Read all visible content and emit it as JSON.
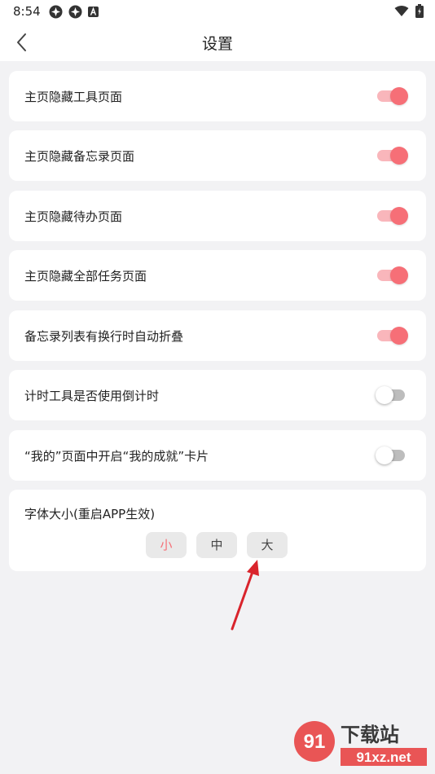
{
  "status_bar": {
    "time": "8:54",
    "left_icons": [
      "app-icon",
      "app-icon",
      "a-badge-icon"
    ],
    "right_icons": [
      "wifi-icon",
      "battery-icon"
    ]
  },
  "app_bar": {
    "title": "设置",
    "back_icon": "chevron-left-icon"
  },
  "settings": [
    {
      "label": "主页隐藏工具页面",
      "on": true
    },
    {
      "label": "主页隐藏备忘录页面",
      "on": true
    },
    {
      "label": "主页隐藏待办页面",
      "on": true
    },
    {
      "label": "主页隐藏全部任务页面",
      "on": true
    },
    {
      "label": "备忘录列表有换行时自动折叠",
      "on": true
    },
    {
      "label": "计时工具是否使用倒计时",
      "on": false
    },
    {
      "label": "“我的”页面中开启“我的成就”卡片",
      "on": false
    }
  ],
  "font_size": {
    "label": "字体大小(重启APP生效)",
    "options": [
      "小",
      "中",
      "大"
    ],
    "selected": "小"
  },
  "annotation": {
    "arrow_color": "#d9242c"
  },
  "watermark": {
    "site_name": "下载站",
    "site_url": "91xz.net",
    "logo_text": "91"
  },
  "colors": {
    "accent": "#f66f77",
    "accent_light": "#f9b6bb",
    "background": "#f2f2f4"
  }
}
